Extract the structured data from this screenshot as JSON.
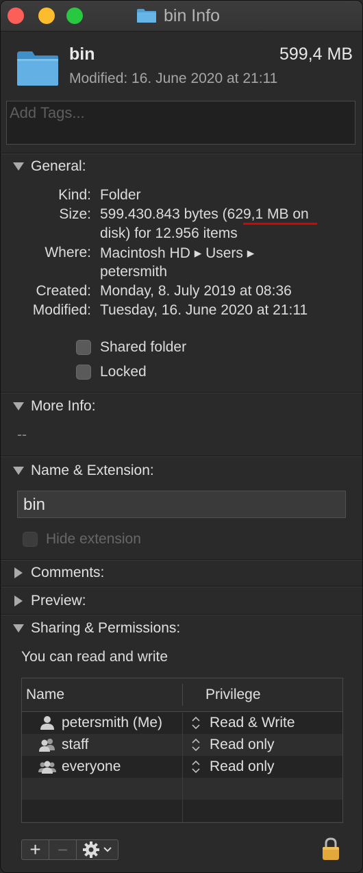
{
  "window": {
    "title": "bin Info"
  },
  "header": {
    "name": "bin",
    "size": "599,4 MB",
    "modified": "Modified: 16. June 2020 at 21:11",
    "tags_placeholder": "Add Tags..."
  },
  "general": {
    "title": "General:",
    "kind_label": "Kind:",
    "kind_value": "Folder",
    "size_label": "Size:",
    "size_value_line1": "599.430.843 bytes (629,1 MB on",
    "size_value_line2": "disk) for 12.956 items",
    "where_label": "Where:",
    "where_value_line1": "Macintosh HD ▸ Users ▸",
    "where_value_line2": "petersmith",
    "created_label": "Created:",
    "created_value": "Monday, 8. July 2019 at 08:36",
    "modified_label": "Modified:",
    "modified_value": "Tuesday, 16. June 2020 at 21:11",
    "shared_folder_label": "Shared folder",
    "locked_label": "Locked"
  },
  "more_info": {
    "title": "More Info:",
    "value": "--"
  },
  "name_ext": {
    "title": "Name & Extension:",
    "name_value": "bin",
    "hide_extension_label": "Hide extension"
  },
  "comments": {
    "title": "Comments:"
  },
  "preview": {
    "title": "Preview:"
  },
  "sharing": {
    "title": "Sharing & Permissions:",
    "note": "You can read and write",
    "col_name": "Name",
    "col_privilege": "Privilege",
    "rows": [
      {
        "name": "petersmith (Me)",
        "privilege": "Read & Write",
        "icon": "user-icon"
      },
      {
        "name": "staff",
        "privilege": "Read only",
        "icon": "group-icon"
      },
      {
        "name": "everyone",
        "privilege": "Read only",
        "icon": "everyone-icon"
      }
    ]
  },
  "toolbar": {
    "add": "+",
    "remove": "−",
    "action": "gear-icon",
    "lock": "lock-icon"
  },
  "colors": {
    "red_underline": "#e00000",
    "folder_blue": "#5aaee0",
    "lock_gold": "#e3a83a"
  }
}
